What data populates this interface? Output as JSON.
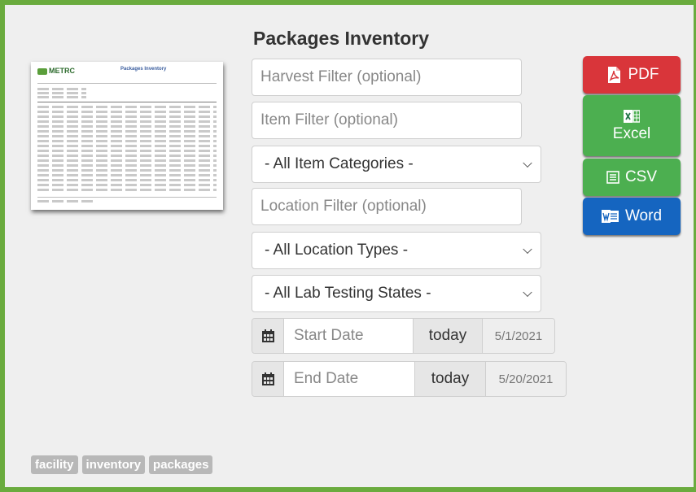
{
  "page": {
    "title": "Packages Inventory"
  },
  "thumbnail": {
    "logo_text": "METRC",
    "title": "Packages Inventory"
  },
  "filters": {
    "harvest_placeholder": "Harvest Filter (optional)",
    "item_placeholder": "Item Filter (optional)",
    "item_categories": "- All Item Categories -",
    "location_placeholder": "Location Filter (optional)",
    "location_types": "- All Location Types -",
    "lab_testing_states": "- All Lab Testing States -"
  },
  "start_date": {
    "placeholder": "Start Date",
    "today_label": "today",
    "value": "5/1/2021"
  },
  "end_date": {
    "placeholder": "End Date",
    "today_label": "today",
    "value": "5/20/2021"
  },
  "exports": {
    "pdf": "PDF",
    "excel": "Excel",
    "csv": "CSV",
    "word": "Word",
    "colors": {
      "pdf": "#d9353a",
      "excel": "#4caf50",
      "csv": "#4caf50",
      "word": "#1565c0"
    }
  },
  "tags": [
    "facility",
    "inventory",
    "packages"
  ],
  "colors": {
    "frame": "#6aab3e",
    "panel": "#efefef"
  }
}
